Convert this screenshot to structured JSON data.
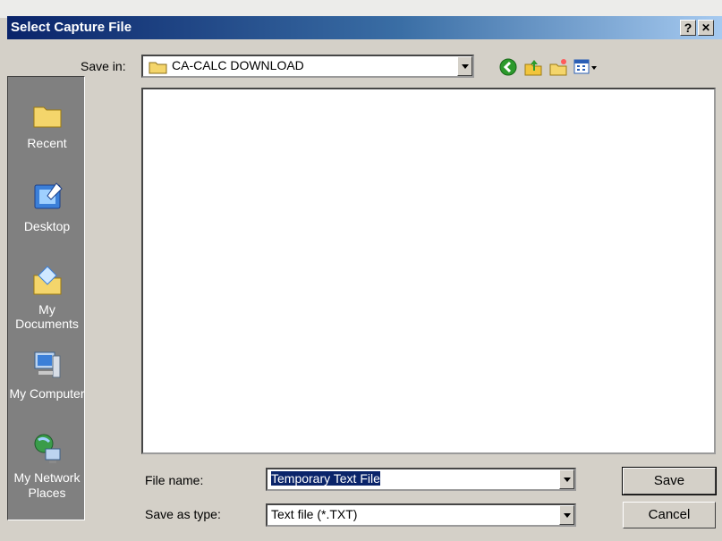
{
  "window": {
    "title": "Select Capture File",
    "help_label": "?",
    "close_label": "✕"
  },
  "toolbar": {
    "save_in_label": "Save in:",
    "location": "CA-CALC DOWNLOAD",
    "icons": [
      "back-icon",
      "up-folder-icon",
      "new-folder-icon",
      "view-menu-icon"
    ]
  },
  "places": [
    {
      "label": "Recent",
      "icon": "recent-icon"
    },
    {
      "label": "Desktop",
      "icon": "desktop-icon"
    },
    {
      "label": "My Documents",
      "icon": "my-documents-icon"
    },
    {
      "label": "My Computer",
      "icon": "my-computer-icon"
    },
    {
      "label": "My Network Places",
      "icon": "network-icon"
    }
  ],
  "form": {
    "file_name_label": "File name:",
    "file_name_value": "Temporary Text File",
    "type_label": "Save as type:",
    "type_value": "Text file (*.TXT)"
  },
  "buttons": {
    "save": "Save",
    "cancel": "Cancel"
  }
}
